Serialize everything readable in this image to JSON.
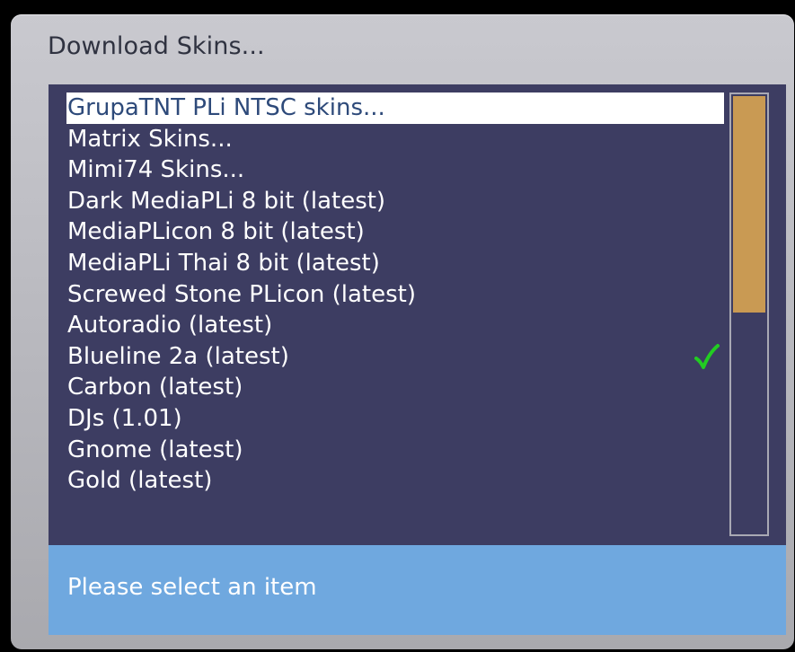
{
  "window": {
    "title": "Download Skins..."
  },
  "list": {
    "items": [
      {
        "label": "GrupaTNT PLi NTSC skins...",
        "selected": true
      },
      {
        "label": "Matrix Skins..."
      },
      {
        "label": "Mimi74 Skins..."
      },
      {
        "label": "Dark MediaPLi 8 bit (latest)"
      },
      {
        "label": "MediaPLicon 8 bit (latest)"
      },
      {
        "label": "MediaPLi Thai 8 bit (latest)"
      },
      {
        "label": "Screwed Stone PLicon (latest)"
      },
      {
        "label": "Autoradio (latest)"
      },
      {
        "label": "Blueline 2a (latest)",
        "installed": true,
        "icon": "check-icon"
      },
      {
        "label": "Carbon (latest)"
      },
      {
        "label": "DJs (1.01)"
      },
      {
        "label": "Gnome (latest)"
      },
      {
        "label": "Gold (latest)"
      }
    ]
  },
  "scrollbar": {
    "thumb_fraction": 0.49,
    "thumb_position": 0
  },
  "status": {
    "text": "Please select an item"
  },
  "colors": {
    "background": "#000000",
    "window": "#b7b7bd",
    "title_text": "#2f3240",
    "list_background": "#3d3d62",
    "list_text": "#ffffff",
    "selection_background": "#ffffff",
    "selection_text": "#2e4a7a",
    "scroll_thumb": "#c99a53",
    "scroll_border": "#a9a9b4",
    "status_background": "#6fa8df",
    "check": "#22cc22"
  }
}
